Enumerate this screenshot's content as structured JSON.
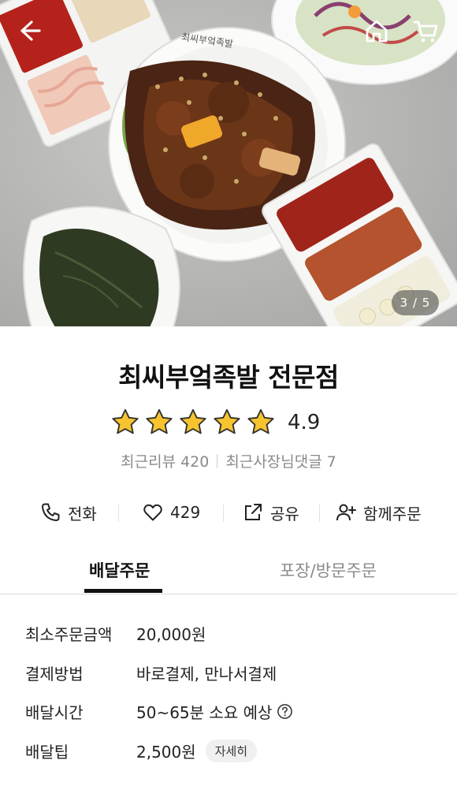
{
  "hero": {
    "page_indicator": "3 / 5",
    "plate_stamp": "최씨부엌족발",
    "icons": {
      "back": "arrow-left-icon",
      "home": "home-icon",
      "cart": "cart-icon"
    }
  },
  "store": {
    "name": "최씨부엌족발 전문점",
    "rating": "4.9",
    "stars": 5,
    "recent_reviews": "최근리뷰 420",
    "owner_comments": "최근사장님댓글 7"
  },
  "actions": {
    "call": "전화",
    "likes": "429",
    "share": "공유",
    "group_order": "함께주문"
  },
  "tabs": {
    "delivery": "배달주문",
    "pickup": "포장/방문주문"
  },
  "details": [
    {
      "label": "최소주문금액",
      "value": "20,000원"
    },
    {
      "label": "결제방법",
      "value": "바로결제, 만나서결제"
    },
    {
      "label": "배달시간",
      "value": "50~65분 소요 예상"
    },
    {
      "label": "배달팁",
      "value": "2,500원",
      "button": "자세히"
    }
  ],
  "colors": {
    "star": "#f7c430",
    "accent": "#111111",
    "muted": "#8a8a8a"
  }
}
